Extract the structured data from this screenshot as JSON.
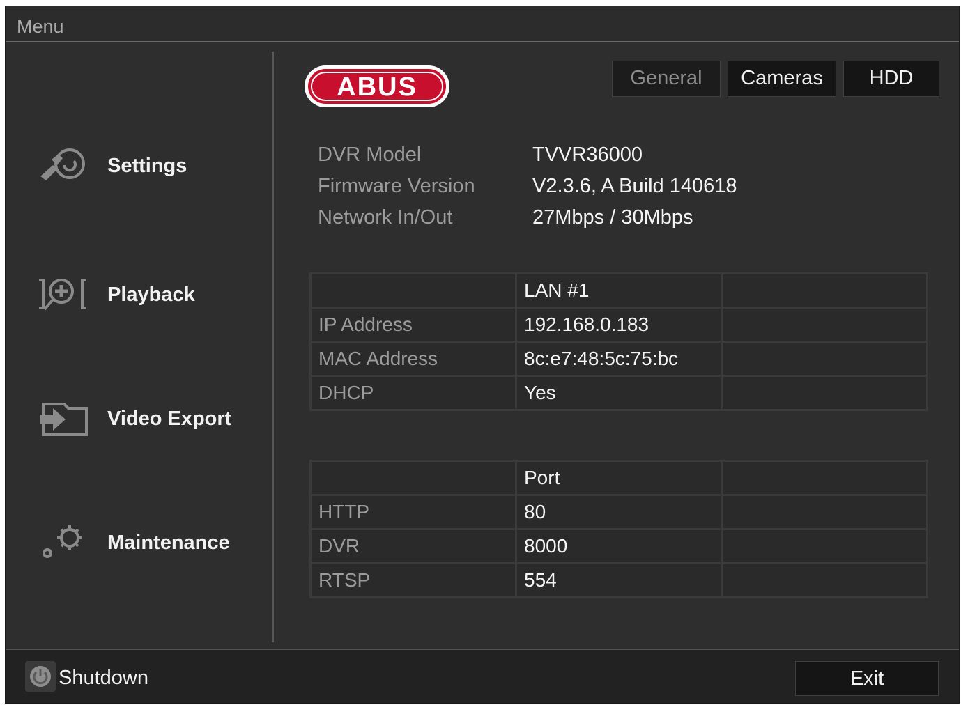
{
  "window": {
    "title": "Menu"
  },
  "brand": {
    "logo_text": "ABUS",
    "logo_color": "#c8102e"
  },
  "sidebar": {
    "items": [
      {
        "label": "Settings",
        "icon": "settings-icon"
      },
      {
        "label": "Playback",
        "icon": "playback-icon"
      },
      {
        "label": "Video Export",
        "icon": "video-export-icon"
      },
      {
        "label": "Maintenance",
        "icon": "maintenance-icon"
      }
    ]
  },
  "tabs": [
    {
      "label": "General",
      "active": true
    },
    {
      "label": "Cameras",
      "active": false
    },
    {
      "label": "HDD",
      "active": false
    }
  ],
  "info": [
    {
      "key": "DVR Model",
      "value": "TVVR36000"
    },
    {
      "key": "Firmware Version",
      "value": "V2.3.6, A Build 140618"
    },
    {
      "key": "Network In/Out",
      "value": "27Mbps / 30Mbps"
    }
  ],
  "lan_table": {
    "header": [
      "",
      "LAN #1",
      ""
    ],
    "rows": [
      [
        "IP Address",
        "192.168.0.183",
        ""
      ],
      [
        "MAC Address",
        "8c:e7:48:5c:75:bc",
        ""
      ],
      [
        "DHCP",
        "Yes",
        ""
      ]
    ]
  },
  "port_table": {
    "header": [
      "",
      "Port",
      ""
    ],
    "rows": [
      [
        "HTTP",
        "80",
        ""
      ],
      [
        "DVR",
        "8000",
        ""
      ],
      [
        "RTSP",
        "554",
        ""
      ]
    ]
  },
  "footer": {
    "shutdown_label": "Shutdown",
    "exit_label": "Exit"
  }
}
